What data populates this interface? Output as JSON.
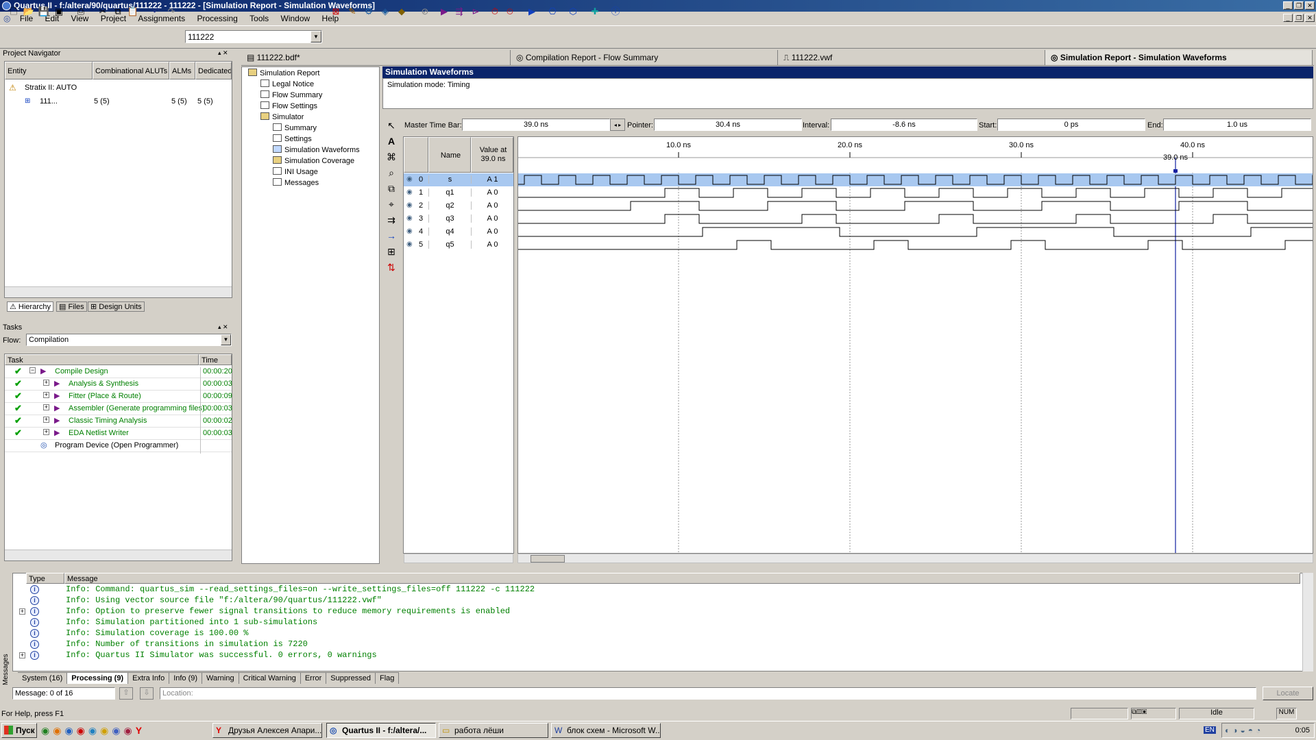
{
  "window": {
    "title": "Quartus II - f:/altera/90/quartus/111222 - 111222 - [Simulation Report - Simulation Waveforms]"
  },
  "menu": [
    "File",
    "Edit",
    "View",
    "Project",
    "Assignments",
    "Processing",
    "Tools",
    "Window",
    "Help"
  ],
  "toolbar": {
    "project_combo": "111222"
  },
  "navigator": {
    "title": "Project Navigator",
    "columns": [
      "Entity",
      "Combinational ALUTs",
      "ALMs",
      "Dedicated"
    ],
    "device": "Stratix II: AUTO",
    "entity": {
      "name": "111...",
      "aluts": "5 (5)",
      "alms": "5 (5)",
      "ded": "5 (5)"
    },
    "tabs": [
      "Hierarchy",
      "Files",
      "Design Units"
    ]
  },
  "tasks": {
    "title": "Tasks",
    "flow_label": "Flow:",
    "flow_value": "Compilation",
    "col_task": "Task",
    "col_time": "Time",
    "items": [
      {
        "name": "Compile Design",
        "time": "00:00:20"
      },
      {
        "name": "Analysis & Synthesis",
        "time": "00:00:03"
      },
      {
        "name": "Fitter (Place & Route)",
        "time": "00:00:09"
      },
      {
        "name": "Assembler (Generate programming files)",
        "time": "00:00:03"
      },
      {
        "name": "Classic Timing Analysis",
        "time": "00:00:02"
      },
      {
        "name": "EDA Netlist Writer",
        "time": "00:00:03"
      },
      {
        "name": "Program Device (Open Programmer)",
        "time": ""
      }
    ]
  },
  "doc_tabs": [
    "111222.bdf*",
    "Compilation Report - Flow Summary",
    "111222.vwf",
    "Simulation Report - Simulation Waveforms"
  ],
  "report_tree": [
    "Simulation Report",
    "Legal Notice",
    "Flow Summary",
    "Flow Settings",
    "Simulator",
    "Summary",
    "Settings",
    "Simulation Waveforms",
    "Simulation Coverage",
    "INI Usage",
    "Messages"
  ],
  "sim": {
    "header": "Simulation Waveforms",
    "mode": "Simulation mode: Timing",
    "master_label": "Master Time Bar:",
    "master_value": "39.0 ns",
    "pointer_label": "Pointer:",
    "pointer_value": "30.4 ns",
    "interval_label": "Interval:",
    "interval_value": "-8.6 ns",
    "start_label": "Start:",
    "start_value": "0 ps",
    "end_label": "End:",
    "end_value": "1.0 us",
    "col_name": "Name",
    "col_value": "Value at\n39.0 ns",
    "time_ticks": [
      "10.0 ns",
      "20.0 ns",
      "30.0 ns",
      "40.0 ns"
    ],
    "marker_label": "39.0 ns",
    "signals": [
      {
        "idx": "0",
        "name": "s",
        "value": "A 1"
      },
      {
        "idx": "1",
        "name": "q1",
        "value": "A 0"
      },
      {
        "idx": "2",
        "name": "q2",
        "value": "A 0"
      },
      {
        "idx": "3",
        "name": "q3",
        "value": "A 0"
      },
      {
        "idx": "4",
        "name": "q4",
        "value": "A 0"
      },
      {
        "idx": "5",
        "name": "q5",
        "value": "A 0"
      }
    ]
  },
  "messages": {
    "col_type": "Type",
    "col_msg": "Message",
    "lines": [
      "Info: Command: quartus_sim --read_settings_files=on --write_settings_files=off 111222 -c 111222",
      "Info: Using vector source file \"f:/altera/90/quartus/111222.vwf\"",
      "Info: Option to preserve fewer signal transitions to reduce memory requirements is enabled",
      "Info: Simulation partitioned into 1 sub-simulations",
      "Info: Simulation coverage is      100.00 %",
      "Info: Number of transitions in simulation is 7220",
      "Info: Quartus II Simulator was successful. 0 errors, 0 warnings"
    ],
    "tabs": [
      "System (16)",
      "Processing (9)",
      "Extra Info",
      "Info (9)",
      "Warning",
      "Critical Warning",
      "Error",
      "Suppressed",
      "Flag"
    ],
    "count": "Message: 0 of 16",
    "location": "Location:",
    "locate": "Locate",
    "side": "Messages"
  },
  "status": {
    "help": "For Help, press F1",
    "idle": "Idle",
    "num": "NUM"
  },
  "taskbar": {
    "start": "Пуск",
    "buttons": [
      "Друзья Алексея Апари...",
      "Quartus II - f:/altera/...",
      "работа лёши",
      "блок схем - Microsoft W..."
    ],
    "lang": "EN",
    "clock": "0:05"
  }
}
